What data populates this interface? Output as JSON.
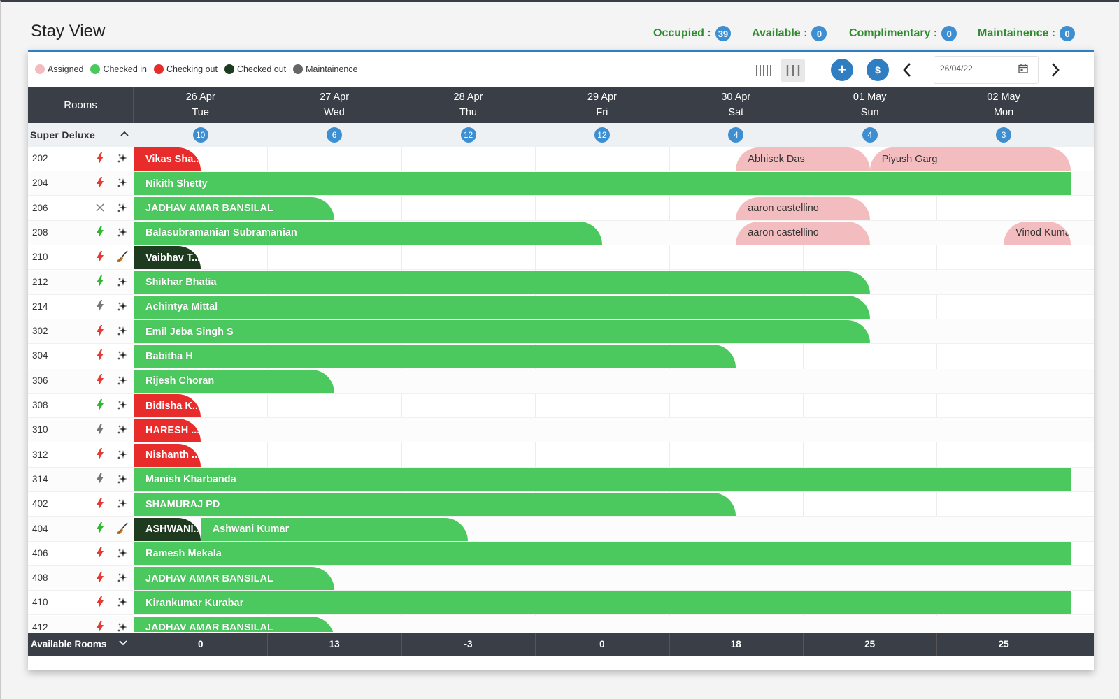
{
  "page": {
    "title": "Stay View"
  },
  "stats": [
    {
      "label": "Occupied :",
      "value": "39"
    },
    {
      "label": "Available :",
      "value": "0"
    },
    {
      "label": "Complimentary :",
      "value": "0"
    },
    {
      "label": "Maintainence :",
      "value": "0"
    }
  ],
  "legend": [
    {
      "label": "Assigned",
      "color": "#f3bcbe"
    },
    {
      "label": "Checked in",
      "color": "#4cc95e"
    },
    {
      "label": "Checking out",
      "color": "#e82b2b"
    },
    {
      "label": "Checked out",
      "color": "#1e3b1f"
    },
    {
      "label": "Maintainence",
      "color": "#666666"
    }
  ],
  "toolbar": {
    "date_value": "26/04/22",
    "add_label": "+",
    "rate_label": "$"
  },
  "header": {
    "rooms_label": "Rooms",
    "dates": [
      {
        "date": "26 Apr",
        "day": "Tue"
      },
      {
        "date": "27 Apr",
        "day": "Wed"
      },
      {
        "date": "28 Apr",
        "day": "Thu"
      },
      {
        "date": "29 Apr",
        "day": "Fri"
      },
      {
        "date": "30 Apr",
        "day": "Sat"
      },
      {
        "date": "01 May",
        "day": "Sun"
      },
      {
        "date": "02 May",
        "day": "Mon"
      }
    ]
  },
  "category": {
    "name": "Super Deluxe",
    "counts": [
      "10",
      "6",
      "12",
      "12",
      "4",
      "4",
      "3"
    ]
  },
  "rooms": [
    {
      "number": "202",
      "status": "red-bolt",
      "bookings": [
        {
          "guest": "Vikas Sha...",
          "state": "out",
          "start": 0,
          "days": 0.5
        },
        {
          "guest": "Abhisek Das",
          "state": "assigned",
          "start": 4.5,
          "days": 1
        },
        {
          "guest": "Piyush Garg",
          "state": "assigned",
          "start": 5.5,
          "days": 1.5
        }
      ]
    },
    {
      "number": "204",
      "status": "red-bolt",
      "bookings": [
        {
          "guest": "Nikith Shetty",
          "state": "in",
          "start": 0,
          "days": 7,
          "full": true
        }
      ]
    },
    {
      "number": "206",
      "status": "x",
      "bookings": [
        {
          "guest": "JADHAV AMAR BANSILAL",
          "state": "in",
          "start": 0,
          "days": 1.5
        },
        {
          "guest": "aaron castellino",
          "state": "assigned",
          "start": 4.5,
          "days": 1
        }
      ]
    },
    {
      "number": "208",
      "status": "green-bolt",
      "bookings": [
        {
          "guest": "Balasubramanian Subramanian",
          "state": "in",
          "start": 0,
          "days": 3.5
        },
        {
          "guest": "aaron castellino",
          "state": "assigned",
          "start": 4.5,
          "days": 1
        },
        {
          "guest": "Vinod Kuma",
          "state": "assigned",
          "start": 6.5,
          "days": 0.5
        }
      ]
    },
    {
      "number": "210",
      "status": "red-bolt",
      "hk": "broom",
      "bookings": [
        {
          "guest": "Vaibhav T...",
          "state": "done",
          "start": 0,
          "days": 0.5
        }
      ]
    },
    {
      "number": "212",
      "status": "green-bolt",
      "bookings": [
        {
          "guest": "Shikhar Bhatia",
          "state": "in",
          "start": 0,
          "days": 5.5
        }
      ]
    },
    {
      "number": "214",
      "status": "grey-bolt",
      "bookings": [
        {
          "guest": "Achintya Mittal",
          "state": "in",
          "start": 0,
          "days": 5.5
        }
      ]
    },
    {
      "number": "302",
      "status": "red-bolt",
      "bookings": [
        {
          "guest": "Emil Jeba Singh S",
          "state": "in",
          "start": 0,
          "days": 5.5
        }
      ]
    },
    {
      "number": "304",
      "status": "red-bolt",
      "bookings": [
        {
          "guest": "Babitha H",
          "state": "in",
          "start": 0,
          "days": 4.5
        }
      ]
    },
    {
      "number": "306",
      "status": "red-bolt",
      "bookings": [
        {
          "guest": "Rijesh Choran",
          "state": "in",
          "start": 0,
          "days": 1.5
        }
      ]
    },
    {
      "number": "308",
      "status": "green-bolt",
      "bookings": [
        {
          "guest": "Bidisha K...",
          "state": "out",
          "start": 0,
          "days": 0.5
        }
      ]
    },
    {
      "number": "310",
      "status": "grey-bolt",
      "bookings": [
        {
          "guest": "HARESH ...",
          "state": "out",
          "start": 0,
          "days": 0.5
        }
      ]
    },
    {
      "number": "312",
      "status": "red-bolt",
      "bookings": [
        {
          "guest": "Nishanth ...",
          "state": "out",
          "start": 0,
          "days": 0.5
        }
      ]
    },
    {
      "number": "314",
      "status": "grey-bolt",
      "bookings": [
        {
          "guest": "Manish Kharbanda",
          "state": "in",
          "start": 0,
          "days": 7,
          "full": true
        }
      ]
    },
    {
      "number": "402",
      "status": "red-bolt",
      "bookings": [
        {
          "guest": "SHAMURAJ PD",
          "state": "in",
          "start": 0,
          "days": 4.5
        }
      ]
    },
    {
      "number": "404",
      "status": "green-bolt",
      "hk": "broom",
      "bookings": [
        {
          "guest": "Ashwani Kumar",
          "state": "in",
          "start": 0.5,
          "days": 2
        },
        {
          "guest": "ASHWANI...",
          "state": "done",
          "start": 0,
          "days": 0.5
        }
      ]
    },
    {
      "number": "406",
      "status": "red-bolt",
      "bookings": [
        {
          "guest": "Ramesh Mekala",
          "state": "in",
          "start": 0,
          "days": 7,
          "full": true
        }
      ]
    },
    {
      "number": "408",
      "status": "red-bolt",
      "bookings": [
        {
          "guest": "JADHAV AMAR BANSILAL",
          "state": "in",
          "start": 0,
          "days": 1.5
        }
      ]
    },
    {
      "number": "410",
      "status": "red-bolt",
      "bookings": [
        {
          "guest": "Kirankumar Kurabar",
          "state": "in",
          "start": 0,
          "days": 7,
          "full": true
        }
      ]
    },
    {
      "number": "412",
      "status": "red-bolt",
      "bookings": [
        {
          "guest": "JADHAV AMAR BANSILAL",
          "state": "in",
          "start": 0,
          "days": 1.5
        }
      ]
    }
  ],
  "footer": {
    "label": "Available Rooms",
    "values": [
      "0",
      "13",
      "-3",
      "0",
      "18",
      "25",
      "25"
    ]
  },
  "colors": {
    "accent": "#2f7ec2",
    "badge": "#3d8fd1",
    "header_bg": "#3a3f47",
    "stat_text": "#2e8b2e"
  }
}
